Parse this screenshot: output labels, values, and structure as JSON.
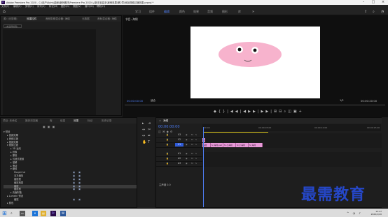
{
  "window": {
    "title": "Adobe Premiere Pro 2020 - C:\\用户\\Adm\\桌面\\案例素材\\Premiere Pro 2020 从新手到高手\\案例效果\\第2章\\添加视频过渡效果.prproj *"
  },
  "menu": [
    "文件(F)",
    "编辑(E)",
    "剪辑(C)",
    "序列(S)",
    "标记(M)",
    "图形(G)",
    "视图(V)",
    "窗口(W)",
    "帮助(H)"
  ],
  "workspaces": [
    "学习",
    "组件",
    "编辑",
    "颜色",
    "效果",
    "音频",
    "图形",
    "库"
  ],
  "active_workspace": "编辑",
  "source_panel": {
    "tabs": [
      "效果控件",
      "音频剪辑混合器: 海绵",
      "元数据",
      "音轨混合器: 海绵"
    ],
    "active_tab": "效果控件",
    "search_placeholder": "(未选择剪辑)"
  },
  "program": {
    "title": "节目: 海绵",
    "tc_left": "00:00:00:00",
    "fit": "适合",
    "half": "1/2",
    "tc_right": "00:00:20:00",
    "controls": [
      "◆",
      "{",
      "}",
      "|◀",
      "◀|",
      "◀",
      "▶",
      "▶|",
      "▶▶|",
      "⊞",
      "⊟",
      "⌕",
      "◫",
      "▣",
      "+"
    ]
  },
  "project_panel": {
    "tabs": [
      "项目: 未命名",
      "媒体浏览器",
      "库",
      "信息",
      "效果",
      "标记",
      "历史记录"
    ],
    "active_tab": "效果",
    "tree": [
      {
        "label": "▾ 预设",
        "indent": 0
      },
      {
        "label": "▸ 音频效果",
        "indent": 1
      },
      {
        "label": "▸ 音频过渡",
        "indent": 1
      },
      {
        "label": "▸ 视频效果",
        "indent": 1
      },
      {
        "label": "▾ 视频过渡",
        "indent": 1
      },
      {
        "label": "▸ 3D 运动",
        "indent": 2
      },
      {
        "label": "▸ 划像",
        "indent": 2
      },
      {
        "label": "▸ 擦除",
        "indent": 2
      },
      {
        "label": "▸ 沉浸式视频",
        "indent": 2
      },
      {
        "label": "▸ 溶解",
        "indent": 2
      },
      {
        "label": "▸ 滑动",
        "indent": 2
      },
      {
        "label": "▾ 缩放",
        "indent": 2
      },
      {
        "label": "MorphCut",
        "indent": 3
      },
      {
        "label": "交叉缩放",
        "indent": 3
      },
      {
        "label": "缩放框",
        "indent": 3
      },
      {
        "label": "缩放拖尾",
        "indent": 3
      },
      {
        "label": "缩放",
        "indent": 3,
        "selected": true
      },
      {
        "label": "缩放框",
        "indent": 3
      },
      {
        "label": "▸ 页面剥落",
        "indent": 2
      },
      {
        "label": "▸ Lumetri 预设",
        "indent": 1
      },
      {
        "label": "缩放",
        "indent": 3
      },
      {
        "label": "▸ 颜色",
        "indent": 1
      }
    ]
  },
  "timeline": {
    "title": "海绵",
    "timecode": "00:00:00:00",
    "ruler": [
      "00:00",
      "00:00:05:00",
      "00:00:10:00",
      "00:00:15:00"
    ],
    "tracks": [
      {
        "label": "V3",
        "selected": false
      },
      {
        "label": "V2",
        "selected": false
      },
      {
        "label": "V1",
        "selected": true
      },
      {
        "label": "A1",
        "selected": false
      },
      {
        "label": "A2",
        "selected": false
      },
      {
        "label": "A3",
        "selected": false
      }
    ],
    "clips": [
      {
        "track": "V2",
        "start": 0,
        "width": 4,
        "label": "fx"
      },
      {
        "track": "V1",
        "start": 0,
        "width": 12,
        "label": "缩放"
      },
      {
        "track": "V1",
        "start": 12,
        "width": 18,
        "label": "fx 海绵.psd"
      },
      {
        "track": "V1",
        "start": 30,
        "width": 18,
        "label": "fx 小海绵"
      },
      {
        "track": "V1",
        "start": 48,
        "width": 18,
        "label": "fx 小海绵"
      },
      {
        "track": "V1",
        "start": 66,
        "width": 20,
        "label": "fx 海绵"
      }
    ],
    "master": "主声道 0.0"
  },
  "watermark": "最需教育",
  "taskbar": {
    "time": "15:47",
    "date": "2022/1/20"
  },
  "colors": {
    "accent": "#4d7cf2",
    "clip": "#e89ad8",
    "ellipse": "#f7b3cd",
    "watermark": "#2547c8"
  }
}
